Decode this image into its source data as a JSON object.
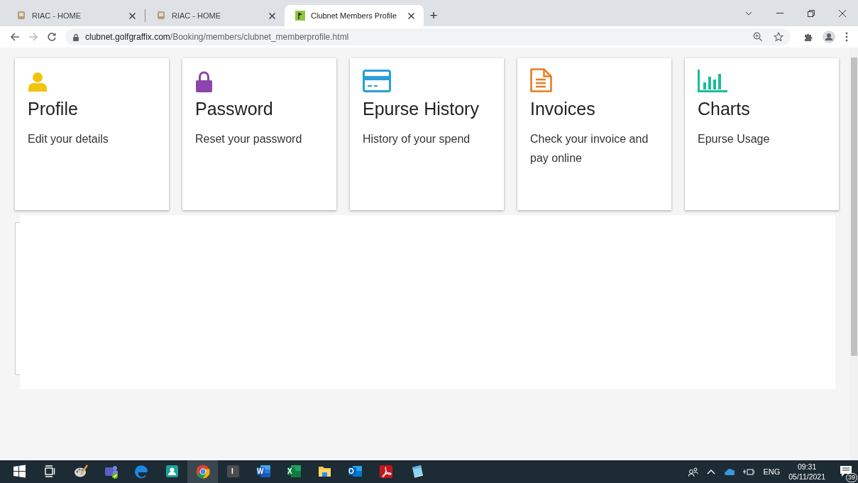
{
  "browser": {
    "tabs": [
      {
        "title": "RIAC - HOME",
        "kind": "crest",
        "selected": false
      },
      {
        "title": "RIAC - HOME",
        "kind": "crest",
        "selected": false
      },
      {
        "title": "Clubnet Members Profile",
        "kind": "flag",
        "selected": true
      }
    ],
    "new_tab": "+",
    "address": {
      "host": "clubnet.golfgraffix.com",
      "path": "/Booking/members/clubnet_memberprofile.html"
    }
  },
  "cards": [
    {
      "kind": "person",
      "color": "#f1c40f",
      "title": "Profile",
      "description": "Edit your details"
    },
    {
      "kind": "lock",
      "color": "#8e44ad",
      "title": "Password",
      "description": "Reset your password"
    },
    {
      "kind": "card",
      "color": "#2a9fd8",
      "title": "Epurse History",
      "description": "History of your spend"
    },
    {
      "kind": "document",
      "color": "#e67e22",
      "title": "Invoices",
      "description": "Check your invoice and pay online"
    },
    {
      "kind": "chart",
      "color": "#1abc9c",
      "title": "Charts",
      "description": "Epurse Usage"
    }
  ],
  "taskbar": {
    "apps": [
      {
        "kind": "start",
        "active": false
      },
      {
        "kind": "taskview",
        "active": false
      },
      {
        "kind": "paint",
        "active": false
      },
      {
        "kind": "teams",
        "active": false
      },
      {
        "kind": "edge",
        "active": false
      },
      {
        "kind": "people",
        "active": false
      },
      {
        "kind": "chrome",
        "active": true
      },
      {
        "kind": "letter",
        "glyph": "I",
        "active": false
      },
      {
        "kind": "word",
        "glyph": "W",
        "active": false
      },
      {
        "kind": "excel",
        "glyph": "X",
        "active": false
      },
      {
        "kind": "explorer",
        "active": false
      },
      {
        "kind": "outlook",
        "glyph": "O",
        "active": false
      },
      {
        "kind": "acrobat",
        "active": false
      },
      {
        "kind": "notepad",
        "active": false
      }
    ],
    "language": "ENG",
    "time": "09:31",
    "date": "05/11/2021",
    "notifications": "39"
  }
}
